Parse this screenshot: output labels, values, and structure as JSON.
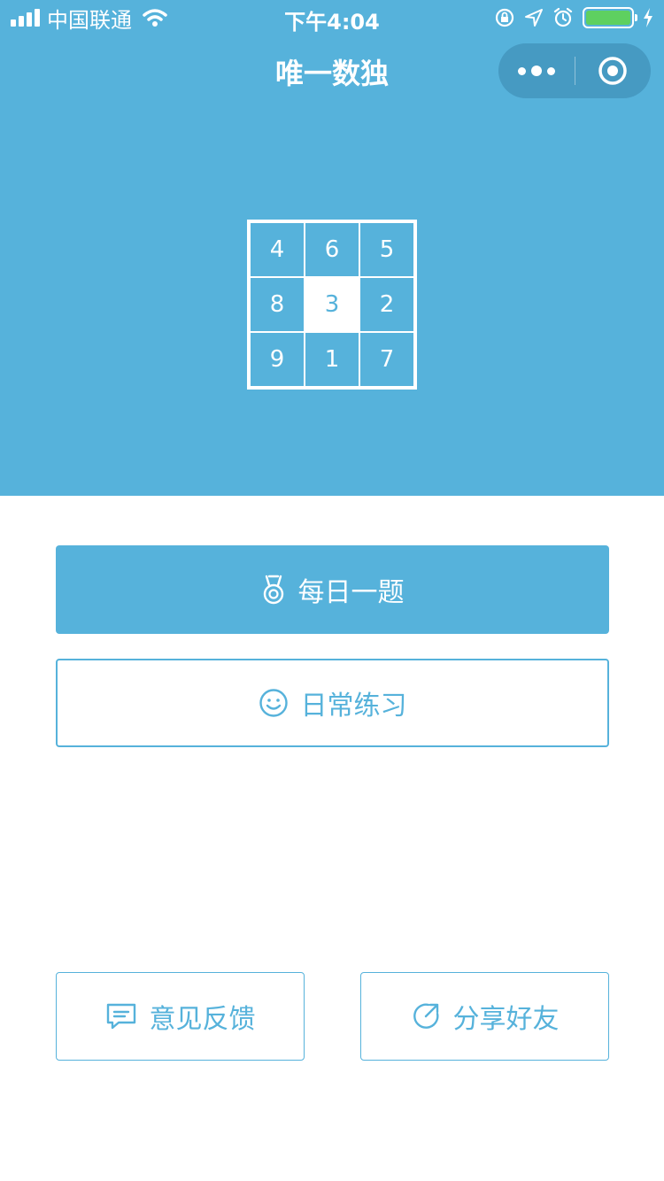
{
  "status_bar": {
    "carrier": "中国联通",
    "time": "下午4:04"
  },
  "nav": {
    "title": "唯一数独"
  },
  "sudoku": {
    "cells": [
      "4",
      "6",
      "5",
      "8",
      "3",
      "2",
      "9",
      "1",
      "7"
    ],
    "highlighted_index": 4
  },
  "buttons": {
    "daily": "每日一题",
    "practice": "日常练习",
    "feedback": "意见反馈",
    "share": "分享好友"
  },
  "colors": {
    "primary": "#56b2db",
    "battery": "#5ed060",
    "white": "#ffffff"
  },
  "icons": {
    "daily": "medal-icon",
    "practice": "smile-icon",
    "feedback": "message-icon",
    "share": "share-icon"
  }
}
